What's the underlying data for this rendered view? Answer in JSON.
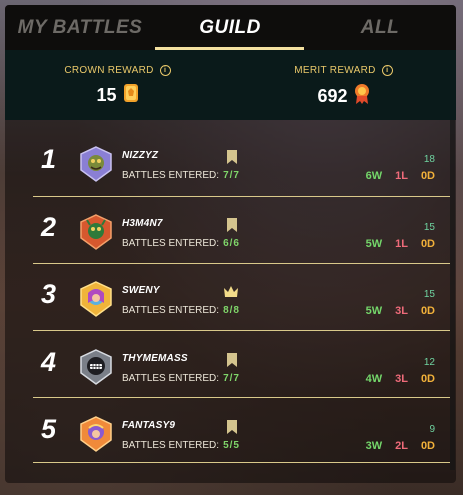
{
  "tabs": [
    {
      "label": "MY BATTLES",
      "active": false
    },
    {
      "label": "GUILD",
      "active": true
    },
    {
      "label": "ALL",
      "active": false
    }
  ],
  "rewards": {
    "crown": {
      "label": "CROWN REWARD",
      "value": "15",
      "icon": "crown-reward-icon"
    },
    "merit": {
      "label": "MERIT REWARD",
      "value": "692",
      "icon": "merit-medal-icon"
    }
  },
  "entered_label": "BATTLES ENTERED:",
  "players": [
    {
      "rank": "1",
      "name": "NIZZYZ",
      "entered": "7/7",
      "score": "18",
      "w": "6W",
      "l": "1L",
      "d": "0D",
      "marker": "bookmark-icon"
    },
    {
      "rank": "2",
      "name": "H3M4N7",
      "entered": "6/6",
      "score": "15",
      "w": "5W",
      "l": "1L",
      "d": "0D",
      "marker": "bookmark-icon"
    },
    {
      "rank": "3",
      "name": "SWENY",
      "entered": "8/8",
      "score": "15",
      "w": "5W",
      "l": "3L",
      "d": "0D",
      "marker": "crown-icon"
    },
    {
      "rank": "4",
      "name": "THYMEMASS",
      "entered": "7/7",
      "score": "12",
      "w": "4W",
      "l": "3L",
      "d": "0D",
      "marker": "bookmark-icon"
    },
    {
      "rank": "5",
      "name": "FANTASY9",
      "entered": "5/5",
      "score": "9",
      "w": "3W",
      "l": "2L",
      "d": "0D",
      "marker": "bookmark-icon"
    }
  ],
  "colors": {
    "accent": "#f3e0a0",
    "win": "#74d66a",
    "loss": "#ef6b7a",
    "draw": "#f2b13a"
  }
}
